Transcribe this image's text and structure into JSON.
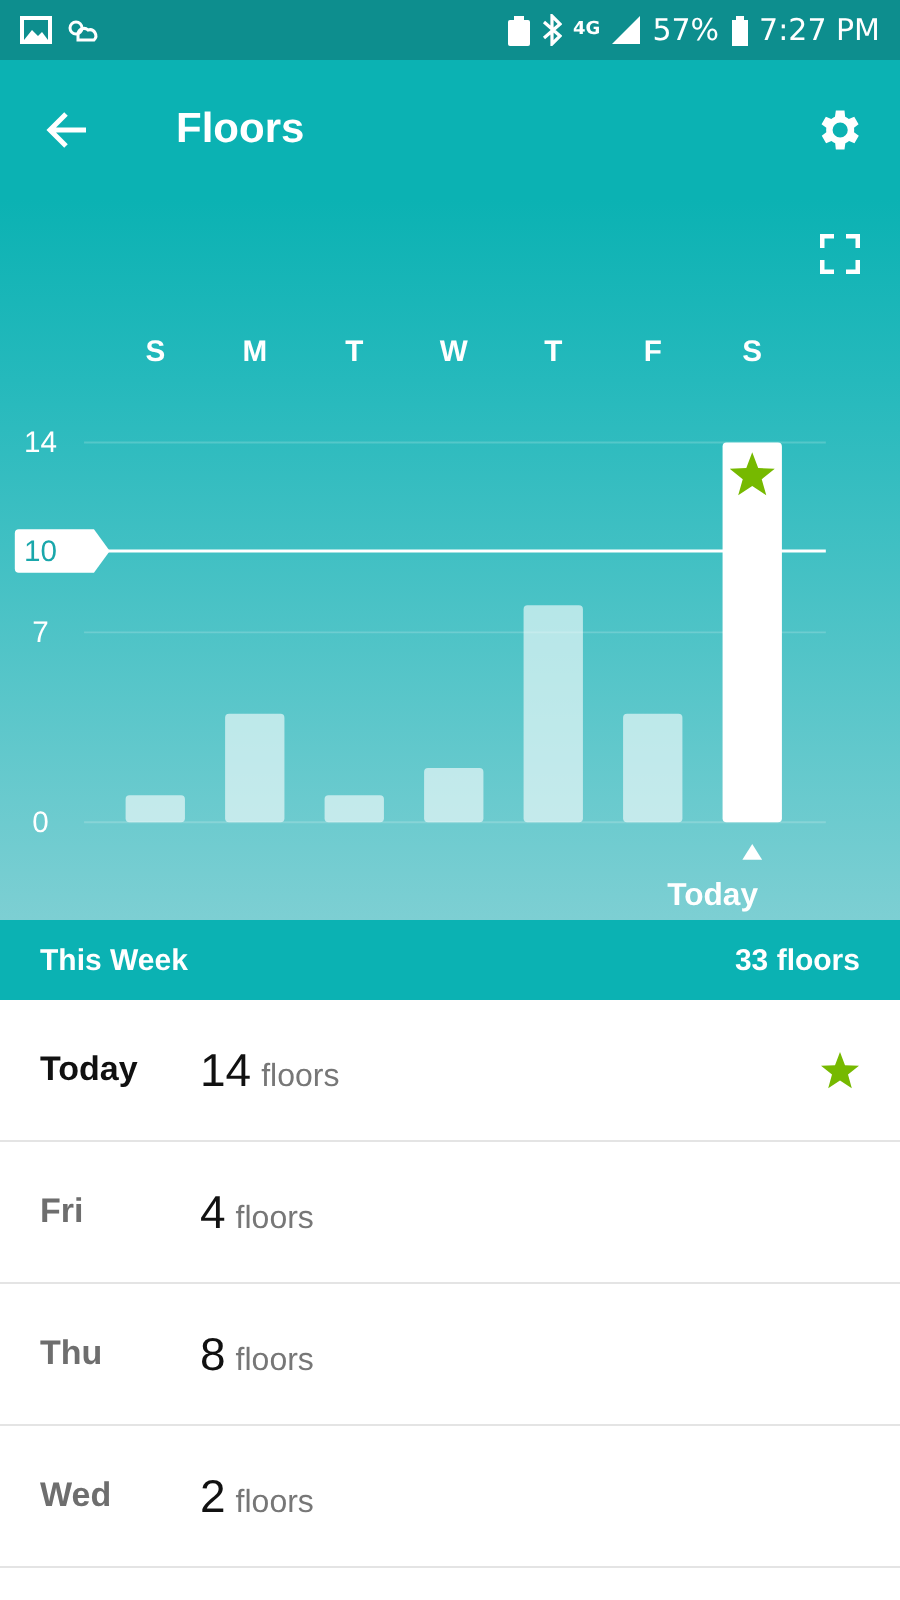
{
  "status_bar": {
    "network": "4G",
    "battery": "57%",
    "time": "7:27 PM"
  },
  "header": {
    "title": "Floors"
  },
  "chart": {
    "chart_data": {
      "type": "bar",
      "categories": [
        "S",
        "M",
        "T",
        "W",
        "T",
        "F",
        "S"
      ],
      "values": [
        1,
        4,
        1,
        2,
        8,
        4,
        14
      ],
      "yticks": [
        0,
        7,
        14
      ],
      "ylim": [
        0,
        14
      ],
      "ref_lines": [
        {
          "axis": "y",
          "value": 10,
          "label": "10"
        }
      ]
    },
    "bars": [
      {
        "selected": false,
        "starred": false
      },
      {
        "selected": false,
        "starred": false
      },
      {
        "selected": false,
        "starred": false
      },
      {
        "selected": false,
        "starred": false
      },
      {
        "selected": false,
        "starred": false
      },
      {
        "selected": false,
        "starred": false
      },
      {
        "selected": true,
        "starred": true
      }
    ],
    "selected_label": "Today"
  },
  "summary": {
    "label": "This Week",
    "total": "33 floors"
  },
  "days": [
    {
      "day": "Today",
      "count": "14",
      "unit": "floors",
      "current": true,
      "starred": true
    },
    {
      "day": "Fri",
      "count": "4",
      "unit": "floors",
      "current": false,
      "starred": false
    },
    {
      "day": "Thu",
      "count": "8",
      "unit": "floors",
      "current": false,
      "starred": false
    },
    {
      "day": "Wed",
      "count": "2",
      "unit": "floors",
      "current": false,
      "starred": false
    }
  ]
}
